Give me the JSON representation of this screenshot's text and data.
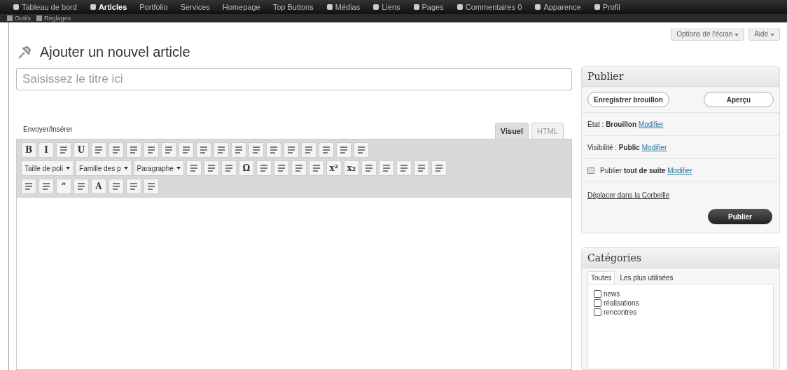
{
  "admin_bar": {
    "items": [
      {
        "label": "Tableau de bord",
        "icon": true,
        "selected": false
      },
      {
        "label": "Articles",
        "icon": true,
        "selected": true
      },
      {
        "label": "Portfolio",
        "icon": false,
        "selected": false
      },
      {
        "label": "Services",
        "icon": false,
        "selected": false
      },
      {
        "label": "Homepage",
        "icon": false,
        "selected": false
      },
      {
        "label": "Top Buttons",
        "icon": false,
        "selected": false
      },
      {
        "label": "Médias",
        "icon": true,
        "selected": false
      },
      {
        "label": "Liens",
        "icon": true,
        "selected": false
      },
      {
        "label": "Pages",
        "icon": true,
        "selected": false
      },
      {
        "label": "Commentaires 0",
        "icon": true,
        "selected": false
      },
      {
        "label": "Apparence",
        "icon": true,
        "selected": false
      },
      {
        "label": "Profil",
        "icon": true,
        "selected": false
      }
    ],
    "second_row": [
      {
        "label": "Outils"
      },
      {
        "label": "Réglages"
      }
    ]
  },
  "header": {
    "title": "Ajouter un nouvel article",
    "buttons": [
      "Options de l'écran",
      "Aide"
    ]
  },
  "title_field": {
    "placeholder": "Saisissez le titre ici"
  },
  "editor": {
    "upload_label": "Envoyer/Insérer",
    "tabs": [
      {
        "label": "Visuel",
        "selected": true
      },
      {
        "label": "HTML",
        "selected": false
      }
    ],
    "toolbar": [
      [
        {
          "kind": "glyph",
          "text": "B"
        },
        {
          "kind": "glyph",
          "text": "I"
        },
        {
          "kind": "icon"
        },
        {
          "kind": "glyph",
          "text": "U"
        },
        {
          "kind": "icon"
        },
        {
          "kind": "icon"
        },
        {
          "kind": "icon"
        },
        {
          "kind": "icon"
        },
        {
          "kind": "icon"
        },
        {
          "kind": "icon"
        },
        {
          "kind": "icon"
        },
        {
          "kind": "icon"
        },
        {
          "kind": "icon"
        },
        {
          "kind": "icon"
        },
        {
          "kind": "icon"
        },
        {
          "kind": "icon"
        },
        {
          "kind": "icon"
        },
        {
          "kind": "icon"
        },
        {
          "kind": "icon"
        },
        {
          "kind": "icon"
        }
      ],
      [
        {
          "kind": "select",
          "text": "Taille de poli"
        },
        {
          "kind": "select",
          "text": "Famille des p"
        },
        {
          "kind": "select",
          "text": "Paragraphe"
        },
        {
          "kind": "icon"
        },
        {
          "kind": "icon"
        },
        {
          "kind": "icon"
        },
        {
          "kind": "glyph",
          "text": "Ω"
        },
        {
          "kind": "icon"
        },
        {
          "kind": "icon"
        },
        {
          "kind": "icon"
        },
        {
          "kind": "icon"
        },
        {
          "kind": "glyph",
          "text": "x²"
        },
        {
          "kind": "glyph",
          "text": "x₂"
        },
        {
          "kind": "icon"
        },
        {
          "kind": "icon"
        },
        {
          "kind": "icon"
        },
        {
          "kind": "icon"
        },
        {
          "kind": "icon"
        }
      ],
      [
        {
          "kind": "icon"
        },
        {
          "kind": "icon"
        },
        {
          "kind": "glyph",
          "text": "“"
        },
        {
          "kind": "icon"
        },
        {
          "kind": "glyph",
          "text": "A"
        },
        {
          "kind": "icon"
        },
        {
          "kind": "icon"
        },
        {
          "kind": "icon"
        }
      ]
    ]
  },
  "publish_box": {
    "title": "Publier",
    "save_button": "Enregistrer brouillon",
    "preview_button": "Aperçu",
    "rows": [
      {
        "label": "État :",
        "value": "Brouillon",
        "link": "Modifier",
        "icon": false
      },
      {
        "label": "Visibilité :",
        "value": "Public",
        "link": "Modifier",
        "icon": false
      },
      {
        "label": "Publier",
        "value": "tout de suite",
        "link": "Modifier",
        "icon": true
      }
    ],
    "trash_link": "Déplacer dans la Corbeille",
    "publish_button": "Publier"
  },
  "categories_box": {
    "title": "Catégories",
    "tabs": [
      {
        "label": "Toutes",
        "selected": true
      },
      {
        "label": "Les plus utilisées",
        "selected": false
      }
    ],
    "items": [
      {
        "label": "news",
        "checked": false
      },
      {
        "label": "réalisations",
        "checked": false
      },
      {
        "label": "rencontres",
        "checked": false
      }
    ]
  }
}
